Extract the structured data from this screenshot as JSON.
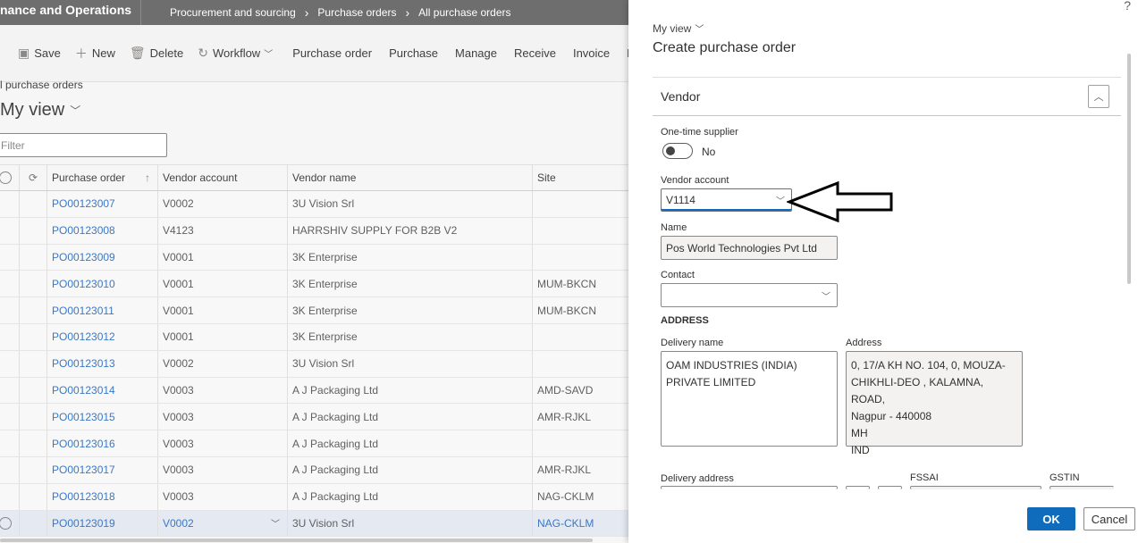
{
  "app": {
    "title": "nance and Operations",
    "breadcrumb": [
      "Procurement and sourcing",
      "Purchase orders",
      "All purchase orders"
    ]
  },
  "actionbar": {
    "save": "Save",
    "new": "New",
    "delete": "Delete",
    "workflow": "Workflow",
    "tabs": [
      "Purchase order",
      "Purchase",
      "Manage",
      "Receive",
      "Invoice",
      "R"
    ]
  },
  "list": {
    "crumb": "l purchase orders",
    "view_title": "My view",
    "filter_placeholder": "Filter",
    "columns": [
      "Purchase order",
      "Vendor account",
      "Vendor name",
      "Site"
    ],
    "rows": [
      {
        "po": "PO00123007",
        "va": "V0002",
        "vn": "3U Vision Srl",
        "site": ""
      },
      {
        "po": "PO00123008",
        "va": "V4123",
        "vn": "HARRSHIV SUPPLY FOR B2B V2",
        "site": ""
      },
      {
        "po": "PO00123009",
        "va": "V0001",
        "vn": "3K Enterprise",
        "site": ""
      },
      {
        "po": "PO00123010",
        "va": "V0001",
        "vn": "3K Enterprise",
        "site": "MUM-BKCN"
      },
      {
        "po": "PO00123011",
        "va": "V0001",
        "vn": "3K Enterprise",
        "site": "MUM-BKCN"
      },
      {
        "po": "PO00123012",
        "va": "V0001",
        "vn": "3K Enterprise",
        "site": ""
      },
      {
        "po": "PO00123013",
        "va": "V0002",
        "vn": "3U Vision Srl",
        "site": ""
      },
      {
        "po": "PO00123014",
        "va": "V0003",
        "vn": "A J Packaging Ltd",
        "site": "AMD-SAVD"
      },
      {
        "po": "PO00123015",
        "va": "V0003",
        "vn": "A J Packaging Ltd",
        "site": "AMR-RJKL"
      },
      {
        "po": "PO00123016",
        "va": "V0003",
        "vn": "A J Packaging Ltd",
        "site": ""
      },
      {
        "po": "PO00123017",
        "va": "V0003",
        "vn": "A J Packaging Ltd",
        "site": "AMR-RJKL"
      },
      {
        "po": "PO00123018",
        "va": "V0003",
        "vn": "A J Packaging Ltd",
        "site": "NAG-CKLM"
      },
      {
        "po": "PO00123019",
        "va": "V0002",
        "vn": "3U Vision Srl",
        "site": "NAG-CKLM"
      }
    ]
  },
  "panel": {
    "help": "?",
    "view": "My view",
    "title": "Create purchase order",
    "section": "Vendor",
    "one_time_label": "One-time supplier",
    "one_time_value": "No",
    "vendor_account_label": "Vendor account",
    "vendor_account_value": "V1114",
    "name_label": "Name",
    "name_value": "Pos World Technologies Pvt Ltd",
    "contact_label": "Contact",
    "contact_value": "",
    "address_heading": "ADDRESS",
    "delivery_name_label": "Delivery name",
    "delivery_name_lines": [
      "OAM INDUSTRIES (INDIA)",
      "PRIVATE LIMITED"
    ],
    "address_label": "Address",
    "address_lines": [
      "0, 17/A KH NO. 104, 0, MOUZA-",
      "CHIKHLI-DEO , KALAMNA, ROAD,",
      "Nagpur - 440008",
      "MH",
      "IND"
    ],
    "delivery_address_label": "Delivery address",
    "fssai_label": "FSSAI",
    "gstin_label": "GSTIN",
    "ok": "OK",
    "cancel": "Cancel"
  },
  "colors": {
    "accent": "#0f6cbd",
    "link": "#3b78c3",
    "topbar": "#6e6e6e"
  }
}
